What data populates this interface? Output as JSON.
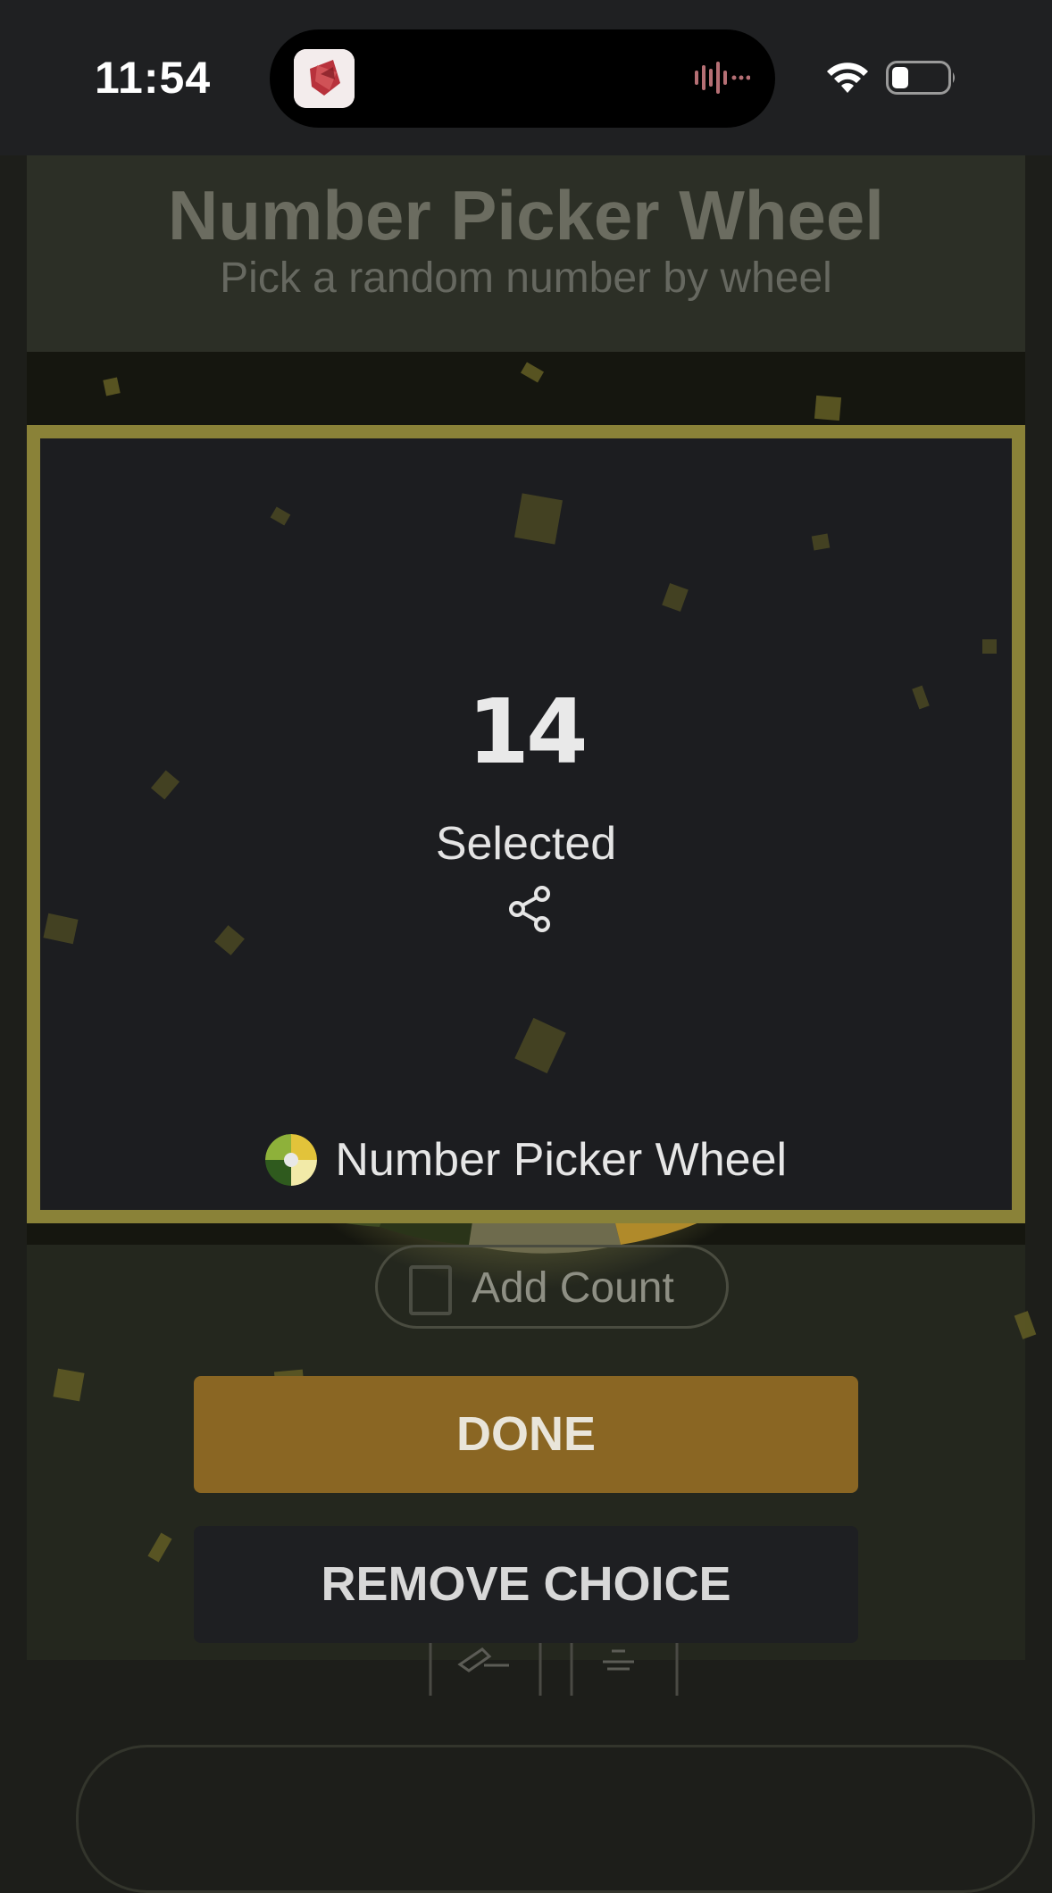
{
  "status_bar": {
    "time": "11:54"
  },
  "page": {
    "title": "Number Picker Wheel",
    "subtitle": "Pick a random number by wheel",
    "add_count_label": "Add Count"
  },
  "result_modal": {
    "value": "14",
    "label": "Selected",
    "footer_brand": "Number Picker Wheel",
    "border_color": "#8a8238"
  },
  "buttons": {
    "done": "DONE",
    "remove_choice": "REMOVE CHOICE"
  },
  "icons": {
    "share": "share-icon",
    "wifi": "wifi-icon",
    "battery": "battery-icon",
    "audio": "audio-wave-icon"
  },
  "colors": {
    "done_button": "#8a6623",
    "remove_button": "#1e1f22"
  }
}
